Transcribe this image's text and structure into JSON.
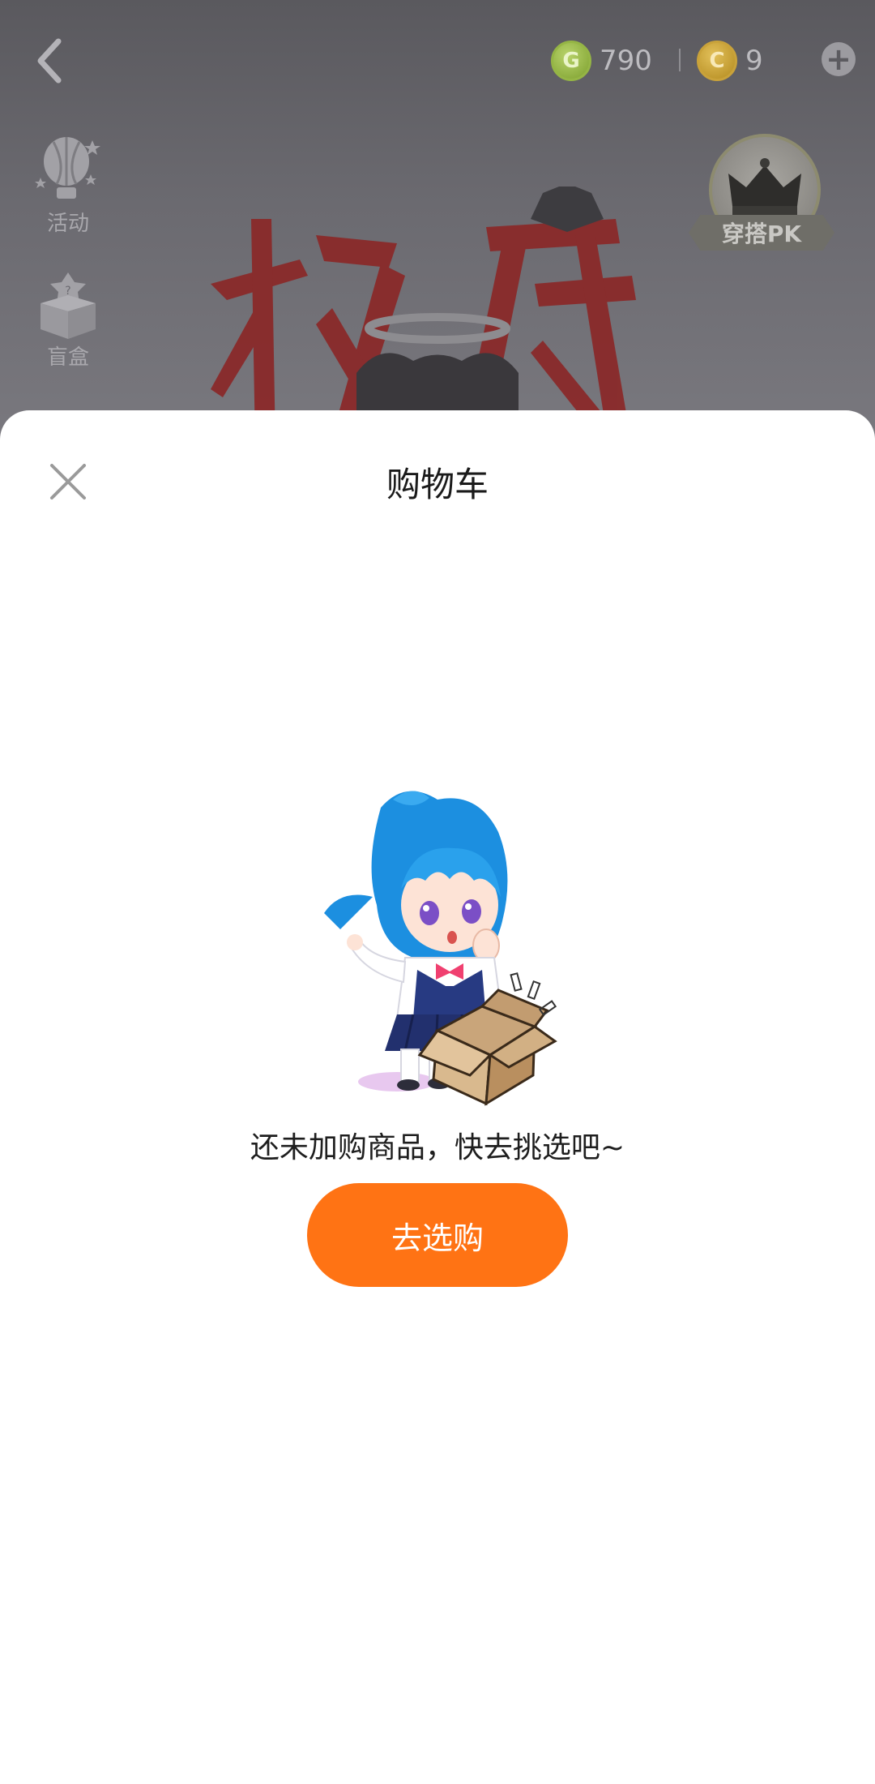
{
  "background": {
    "currency": [
      {
        "icon": "g-coin-icon",
        "symbol": "G",
        "amount": "790"
      },
      {
        "icon": "c-coin-icon",
        "symbol": "C",
        "amount": "9"
      }
    ],
    "side_menu": [
      {
        "label": "活动",
        "icon": "hot-air-balloon-icon"
      },
      {
        "label": "盲盒",
        "icon": "blind-box-icon"
      }
    ],
    "pk_badge_label": "穿搭PK",
    "title_art_icon": "title-calligraphy-icon"
  },
  "cart_sheet": {
    "title": "购物车",
    "empty_message": "还未加购商品，快去挑选吧~",
    "shop_button_label": "去选购",
    "illustration_icon": "girl-with-empty-box-illustration"
  },
  "colors": {
    "accent": "#ff7314",
    "overlay": "#6b6a70"
  }
}
